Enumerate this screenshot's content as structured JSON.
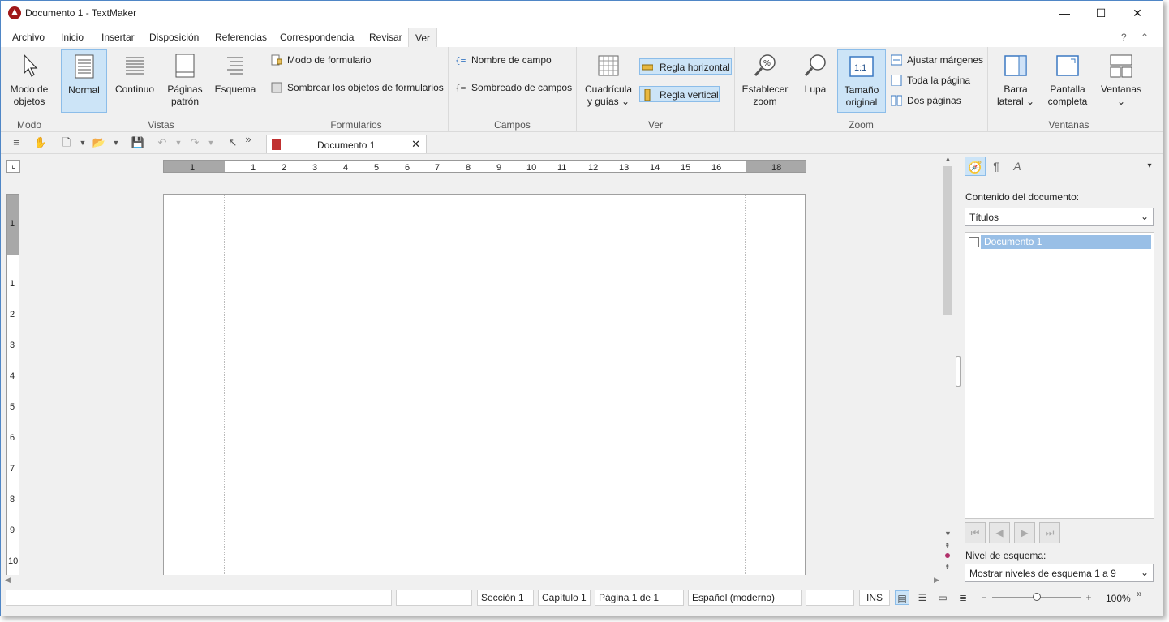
{
  "window": {
    "title": "Documento 1 - TextMaker",
    "minimize": "—",
    "maximize": "☐",
    "close": "✕"
  },
  "menu": [
    "Archivo",
    "Inicio",
    "Insertar",
    "Disposición",
    "Referencias",
    "Correspondencia",
    "Revisar",
    "Ver"
  ],
  "menu_active": "Ver",
  "menu_right": {
    "help": "?",
    "collapse": "⌃"
  },
  "ribbon": {
    "modo": {
      "label": "Modo",
      "objects_line1": "Modo de",
      "objects_line2": "objetos"
    },
    "vistas": {
      "label": "Vistas",
      "normal": "Normal",
      "continuo": "Continuo",
      "paginas_line1": "Páginas",
      "paginas_line2": "patrón",
      "esquema": "Esquema"
    },
    "formularios": {
      "label": "Formularios",
      "modo": "Modo de formulario",
      "sombrear": "Sombrear los objetos de formularios"
    },
    "campos": {
      "label": "Campos",
      "nombre": "Nombre de campo",
      "sombreado": "Sombreado de campos"
    },
    "ver": {
      "label": "Ver",
      "cuadricula_line1": "Cuadrícula",
      "cuadricula_line2": "y guías ⌄",
      "regla_h": "Regla horizontal",
      "regla_v": "Regla vertical"
    },
    "zoom": {
      "label": "Zoom",
      "establecer_line1": "Establecer",
      "establecer_line2": "zoom",
      "lupa": "Lupa",
      "tamano_line1": "Tamaño",
      "tamano_line2": "original",
      "tamano_icon": "1:1",
      "ajustar": "Ajustar márgenes",
      "toda": "Toda la página",
      "dos": "Dos páginas"
    },
    "ventanas": {
      "label": "Ventanas",
      "barra_line1": "Barra",
      "barra_line2": "lateral ⌄",
      "pantalla_line1": "Pantalla",
      "pantalla_line2": "completa",
      "ventanas_line1": "Ventanas",
      "ventanas_line2": "⌄"
    }
  },
  "toolbar": {
    "more": "»"
  },
  "doc_tab": {
    "label": "Documento 1",
    "close": "✕"
  },
  "ruler_h": [
    "1",
    "1",
    "2",
    "3",
    "4",
    "5",
    "6",
    "7",
    "8",
    "9",
    "10",
    "11",
    "12",
    "13",
    "14",
    "15",
    "16",
    "18"
  ],
  "ruler_v": [
    "1",
    "1",
    "2",
    "3",
    "4",
    "5",
    "6",
    "7",
    "8",
    "9",
    "10"
  ],
  "sidebar": {
    "contenido_label": "Contenido del documento:",
    "filter_value": "Títulos",
    "tree_item": "Documento 1",
    "nivel_label": "Nivel de esquema:",
    "nivel_value": "Mostrar niveles de esquema 1 a 9",
    "menu_arrow": "▾"
  },
  "status": {
    "seccion": "Sección 1",
    "capitulo": "Capítulo 1",
    "pagina": "Página 1 de 1",
    "idioma": "Español (moderno)",
    "ins": "INS",
    "zoom": "100%",
    "zoom_minus": "−",
    "zoom_plus": "+",
    "more": "»"
  },
  "zoom_level": 0.5,
  "accent_color": "#cce4f7"
}
